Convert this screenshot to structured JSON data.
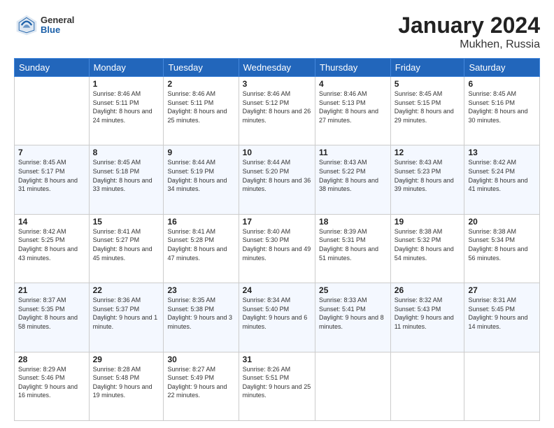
{
  "header": {
    "logo": {
      "general": "General",
      "blue": "Blue"
    },
    "title": "January 2024",
    "subtitle": "Mukhen, Russia"
  },
  "weekdays": [
    "Sunday",
    "Monday",
    "Tuesday",
    "Wednesday",
    "Thursday",
    "Friday",
    "Saturday"
  ],
  "weeks": [
    [
      {
        "day": "",
        "sunrise": "",
        "sunset": "",
        "daylight": ""
      },
      {
        "day": "1",
        "sunrise": "Sunrise: 8:46 AM",
        "sunset": "Sunset: 5:11 PM",
        "daylight": "Daylight: 8 hours and 24 minutes."
      },
      {
        "day": "2",
        "sunrise": "Sunrise: 8:46 AM",
        "sunset": "Sunset: 5:11 PM",
        "daylight": "Daylight: 8 hours and 25 minutes."
      },
      {
        "day": "3",
        "sunrise": "Sunrise: 8:46 AM",
        "sunset": "Sunset: 5:12 PM",
        "daylight": "Daylight: 8 hours and 26 minutes."
      },
      {
        "day": "4",
        "sunrise": "Sunrise: 8:46 AM",
        "sunset": "Sunset: 5:13 PM",
        "daylight": "Daylight: 8 hours and 27 minutes."
      },
      {
        "day": "5",
        "sunrise": "Sunrise: 8:45 AM",
        "sunset": "Sunset: 5:15 PM",
        "daylight": "Daylight: 8 hours and 29 minutes."
      },
      {
        "day": "6",
        "sunrise": "Sunrise: 8:45 AM",
        "sunset": "Sunset: 5:16 PM",
        "daylight": "Daylight: 8 hours and 30 minutes."
      }
    ],
    [
      {
        "day": "7",
        "sunrise": "Sunrise: 8:45 AM",
        "sunset": "Sunset: 5:17 PM",
        "daylight": "Daylight: 8 hours and 31 minutes."
      },
      {
        "day": "8",
        "sunrise": "Sunrise: 8:45 AM",
        "sunset": "Sunset: 5:18 PM",
        "daylight": "Daylight: 8 hours and 33 minutes."
      },
      {
        "day": "9",
        "sunrise": "Sunrise: 8:44 AM",
        "sunset": "Sunset: 5:19 PM",
        "daylight": "Daylight: 8 hours and 34 minutes."
      },
      {
        "day": "10",
        "sunrise": "Sunrise: 8:44 AM",
        "sunset": "Sunset: 5:20 PM",
        "daylight": "Daylight: 8 hours and 36 minutes."
      },
      {
        "day": "11",
        "sunrise": "Sunrise: 8:43 AM",
        "sunset": "Sunset: 5:22 PM",
        "daylight": "Daylight: 8 hours and 38 minutes."
      },
      {
        "day": "12",
        "sunrise": "Sunrise: 8:43 AM",
        "sunset": "Sunset: 5:23 PM",
        "daylight": "Daylight: 8 hours and 39 minutes."
      },
      {
        "day": "13",
        "sunrise": "Sunrise: 8:42 AM",
        "sunset": "Sunset: 5:24 PM",
        "daylight": "Daylight: 8 hours and 41 minutes."
      }
    ],
    [
      {
        "day": "14",
        "sunrise": "Sunrise: 8:42 AM",
        "sunset": "Sunset: 5:25 PM",
        "daylight": "Daylight: 8 hours and 43 minutes."
      },
      {
        "day": "15",
        "sunrise": "Sunrise: 8:41 AM",
        "sunset": "Sunset: 5:27 PM",
        "daylight": "Daylight: 8 hours and 45 minutes."
      },
      {
        "day": "16",
        "sunrise": "Sunrise: 8:41 AM",
        "sunset": "Sunset: 5:28 PM",
        "daylight": "Daylight: 8 hours and 47 minutes."
      },
      {
        "day": "17",
        "sunrise": "Sunrise: 8:40 AM",
        "sunset": "Sunset: 5:30 PM",
        "daylight": "Daylight: 8 hours and 49 minutes."
      },
      {
        "day": "18",
        "sunrise": "Sunrise: 8:39 AM",
        "sunset": "Sunset: 5:31 PM",
        "daylight": "Daylight: 8 hours and 51 minutes."
      },
      {
        "day": "19",
        "sunrise": "Sunrise: 8:38 AM",
        "sunset": "Sunset: 5:32 PM",
        "daylight": "Daylight: 8 hours and 54 minutes."
      },
      {
        "day": "20",
        "sunrise": "Sunrise: 8:38 AM",
        "sunset": "Sunset: 5:34 PM",
        "daylight": "Daylight: 8 hours and 56 minutes."
      }
    ],
    [
      {
        "day": "21",
        "sunrise": "Sunrise: 8:37 AM",
        "sunset": "Sunset: 5:35 PM",
        "daylight": "Daylight: 8 hours and 58 minutes."
      },
      {
        "day": "22",
        "sunrise": "Sunrise: 8:36 AM",
        "sunset": "Sunset: 5:37 PM",
        "daylight": "Daylight: 9 hours and 1 minute."
      },
      {
        "day": "23",
        "sunrise": "Sunrise: 8:35 AM",
        "sunset": "Sunset: 5:38 PM",
        "daylight": "Daylight: 9 hours and 3 minutes."
      },
      {
        "day": "24",
        "sunrise": "Sunrise: 8:34 AM",
        "sunset": "Sunset: 5:40 PM",
        "daylight": "Daylight: 9 hours and 6 minutes."
      },
      {
        "day": "25",
        "sunrise": "Sunrise: 8:33 AM",
        "sunset": "Sunset: 5:41 PM",
        "daylight": "Daylight: 9 hours and 8 minutes."
      },
      {
        "day": "26",
        "sunrise": "Sunrise: 8:32 AM",
        "sunset": "Sunset: 5:43 PM",
        "daylight": "Daylight: 9 hours and 11 minutes."
      },
      {
        "day": "27",
        "sunrise": "Sunrise: 8:31 AM",
        "sunset": "Sunset: 5:45 PM",
        "daylight": "Daylight: 9 hours and 14 minutes."
      }
    ],
    [
      {
        "day": "28",
        "sunrise": "Sunrise: 8:29 AM",
        "sunset": "Sunset: 5:46 PM",
        "daylight": "Daylight: 9 hours and 16 minutes."
      },
      {
        "day": "29",
        "sunrise": "Sunrise: 8:28 AM",
        "sunset": "Sunset: 5:48 PM",
        "daylight": "Daylight: 9 hours and 19 minutes."
      },
      {
        "day": "30",
        "sunrise": "Sunrise: 8:27 AM",
        "sunset": "Sunset: 5:49 PM",
        "daylight": "Daylight: 9 hours and 22 minutes."
      },
      {
        "day": "31",
        "sunrise": "Sunrise: 8:26 AM",
        "sunset": "Sunset: 5:51 PM",
        "daylight": "Daylight: 9 hours and 25 minutes."
      },
      {
        "day": "",
        "sunrise": "",
        "sunset": "",
        "daylight": ""
      },
      {
        "day": "",
        "sunrise": "",
        "sunset": "",
        "daylight": ""
      },
      {
        "day": "",
        "sunrise": "",
        "sunset": "",
        "daylight": ""
      }
    ]
  ]
}
